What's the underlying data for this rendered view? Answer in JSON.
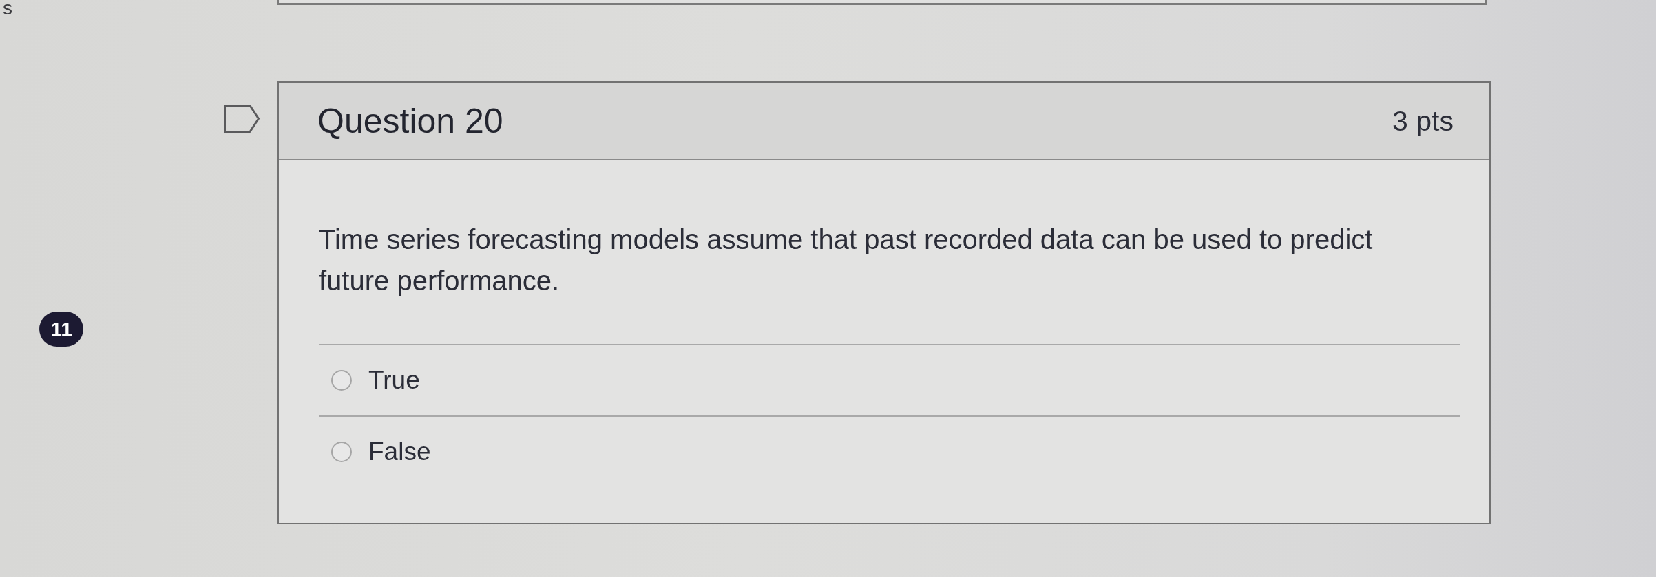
{
  "cut_off_text": "s",
  "badge": {
    "count": "11"
  },
  "question": {
    "flagged": false,
    "title": "Question 20",
    "points": "3 pts",
    "text": "Time series forecasting models assume that past recorded data can be used to predict future performance.",
    "answers": [
      {
        "label": "True",
        "selected": false
      },
      {
        "label": "False",
        "selected": false
      }
    ]
  }
}
